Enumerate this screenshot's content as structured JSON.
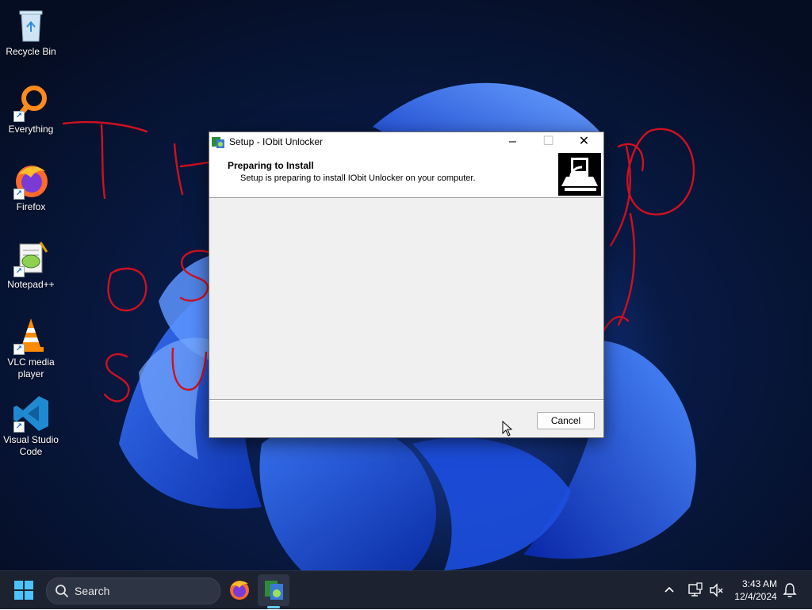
{
  "desktop": {
    "icons": [
      {
        "label": "Recycle Bin"
      },
      {
        "label": "Everything"
      },
      {
        "label": "Firefox"
      },
      {
        "label": "Notepad++"
      },
      {
        "label": "VLC media\nplayer"
      },
      {
        "label": "Visual Studio\nCode"
      }
    ]
  },
  "setup_window": {
    "title": "Setup - IObit Unlocker",
    "header_title": "Preparing to Install",
    "header_subtitle": "Setup is preparing to install IObit Unlocker on your computer.",
    "cancel_label": "Cancel",
    "controls": {
      "minimize": "–",
      "maximize": "☐",
      "close": "✕"
    }
  },
  "taskbar": {
    "search_placeholder": "Search",
    "clock_time": "3:43 AM",
    "clock_date": "12/4/2024",
    "pinned": [
      "firefox-icon",
      "setup-iobit-icon"
    ]
  },
  "colors": {
    "accent": "#4cc2ff",
    "scribble": "#d01020",
    "taskbar": "#1c2230"
  }
}
